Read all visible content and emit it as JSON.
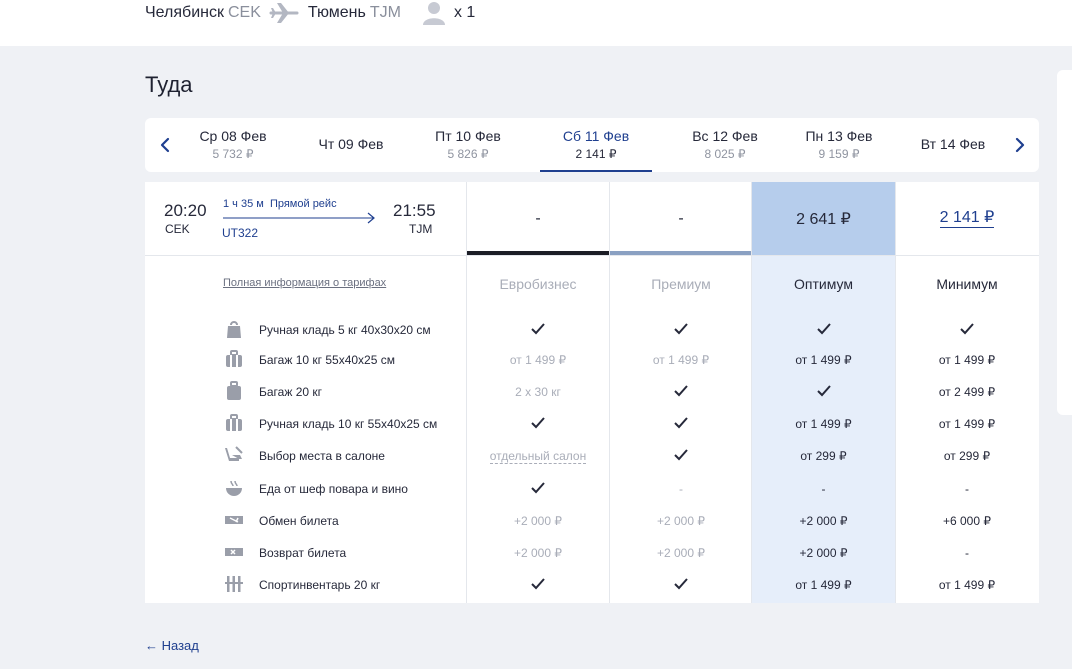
{
  "header": {
    "from_city": "Челябинск",
    "from_code": "CEK",
    "to_city": "Тюмень",
    "to_code": "TJM",
    "passengers": "x 1",
    "plane_icon": "plane-icon",
    "passenger_icon": "person-icon"
  },
  "section_title": "Туда",
  "dates": [
    {
      "day": "Ср 08 Фев",
      "price": "5 732 ₽",
      "selected": false
    },
    {
      "day": "Чт 09 Фев",
      "price": "",
      "selected": false
    },
    {
      "day": "Пт 10 Фев",
      "price": "5 826 ₽",
      "selected": false
    },
    {
      "day": "Сб 11 Фев",
      "price": "2 141 ₽",
      "selected": true
    },
    {
      "day": "Вс 12 Фев",
      "price": "8 025 ₽",
      "selected": false
    },
    {
      "day": "Пн 13 Фев",
      "price": "9 159 ₽",
      "selected": false
    },
    {
      "day": "Вт 14 Фев",
      "price": "",
      "selected": false
    }
  ],
  "flight": {
    "dep_time": "20:20",
    "dep_code": "CEK",
    "duration": "1 ч 35 м",
    "type": "Прямой рейс",
    "flight_number": "UT322",
    "arr_time": "21:55",
    "arr_code": "TJM"
  },
  "fares": [
    {
      "name": "Евробизнес",
      "price": "-",
      "bar_color": "#1b1d26",
      "highlight": false
    },
    {
      "name": "Премиум",
      "price": "-",
      "bar_color": "#8aa0c2",
      "highlight": false
    },
    {
      "name": "Оптимум",
      "price": "2 641 ₽",
      "bar_color": "",
      "highlight": true
    },
    {
      "name": "Минимум",
      "price": "2 141 ₽",
      "bar_color": "",
      "highlight": false
    }
  ],
  "full_info_link": "Полная информация о тарифах",
  "features": [
    {
      "icon": "hand-bag-icon",
      "label": "Ручная кладь 5 кг 40x30x20 см",
      "values": [
        "✓",
        "✓",
        "✓",
        "✓"
      ]
    },
    {
      "icon": "baggage-icon",
      "label": "Багаж 10 кг 55x40x25 см",
      "values": [
        "от 1 499 ₽",
        "от 1 499 ₽",
        "от 1 499 ₽",
        "от 1 499 ₽"
      ]
    },
    {
      "icon": "suitcase-icon",
      "label": "Багаж 20 кг",
      "values": [
        "2 x 30 кг",
        "✓",
        "✓",
        "от 2 499 ₽"
      ]
    },
    {
      "icon": "carry-on-icon",
      "label": "Ручная кладь 10 кг 55x40x25 см",
      "values": [
        "✓",
        "✓",
        "от 1 499 ₽",
        "от 1 499 ₽"
      ]
    },
    {
      "icon": "seat-icon",
      "label": "Выбор места в салоне",
      "values": [
        "отдельный салон",
        "✓",
        "от 299 ₽",
        "от 299 ₽"
      ]
    },
    {
      "icon": "meal-icon",
      "label": "Еда от шеф повара и вино",
      "values": [
        "✓",
        "-",
        "-",
        "-"
      ]
    },
    {
      "icon": "ticket-exchange-icon",
      "label": "Обмен билета",
      "values": [
        "+2 000 ₽",
        "+2 000 ₽",
        "+2 000 ₽",
        "+6 000 ₽"
      ]
    },
    {
      "icon": "ticket-refund-icon",
      "label": "Возврат билета",
      "values": [
        "+2 000 ₽",
        "+2 000 ₽",
        "+2 000 ₽",
        "-"
      ]
    },
    {
      "icon": "sport-equipment-icon",
      "label": "Спортинвентарь 20 кг",
      "values": [
        "✓",
        "✓",
        "от 1 499 ₽",
        "от 1 499 ₽"
      ]
    }
  ],
  "back_link": "← Назад",
  "colors": {
    "accent": "#1f3f8f",
    "optimum_header": "#b6cdec",
    "optimum_column": "#e6eefa",
    "muted_text": "#a9adb8"
  }
}
